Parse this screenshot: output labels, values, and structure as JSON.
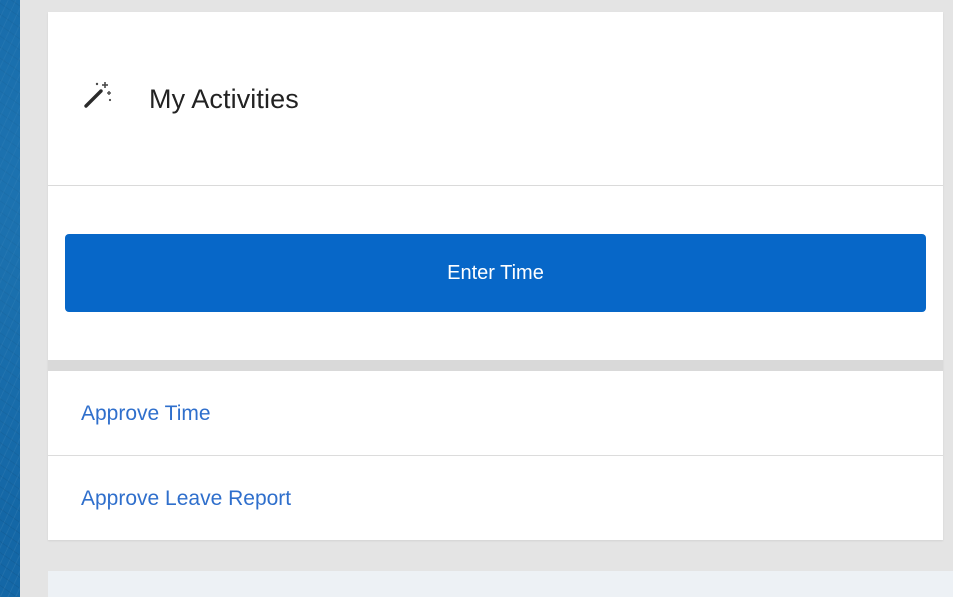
{
  "widget": {
    "title": "My Activities",
    "icon": "magic-wand-icon"
  },
  "primary_action": {
    "label": "Enter Time"
  },
  "links": [
    {
      "label": "Approve Time"
    },
    {
      "label": "Approve Leave Report"
    }
  ],
  "colors": {
    "background": "#1467a6",
    "panel": "#e4e4e4",
    "button": "#0767c8",
    "link": "#2f6fcc"
  }
}
